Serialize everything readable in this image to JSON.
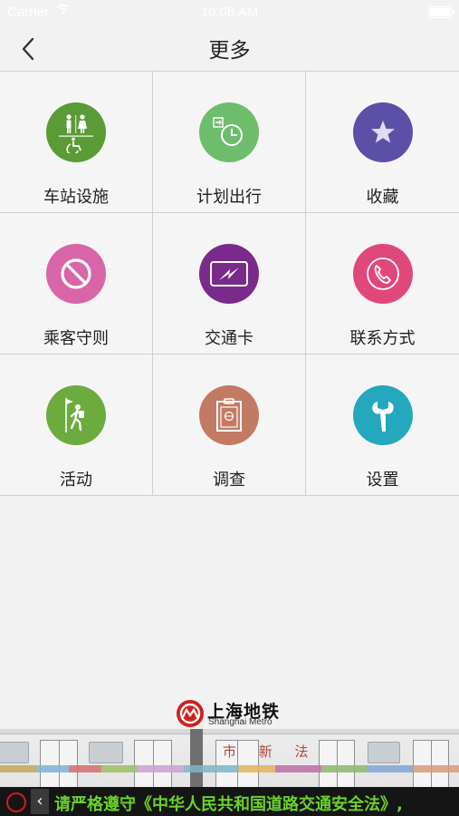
{
  "status_bar": {
    "carrier": "Carrier",
    "time": "10:08 AM"
  },
  "nav": {
    "title": "更多"
  },
  "items": [
    {
      "label": "车站设施",
      "icon": "restroom-accessibility-icon",
      "color": "#5a9b35"
    },
    {
      "label": "计划出行",
      "icon": "plan-clock-icon",
      "color": "#6dbd6d"
    },
    {
      "label": "收藏",
      "icon": "star-icon",
      "color": "#5c4fa8"
    },
    {
      "label": "乘客守则",
      "icon": "prohibited-icon",
      "color": "#d965a9"
    },
    {
      "label": "交通卡",
      "icon": "transit-card-icon",
      "color": "#7a2a8a"
    },
    {
      "label": "联系方式",
      "icon": "phone-icon",
      "color": "#e0487a"
    },
    {
      "label": "活动",
      "icon": "hiker-flag-icon",
      "color": "#6cab3e"
    },
    {
      "label": "调查",
      "icon": "clipboard-survey-icon",
      "color": "#c27a63"
    },
    {
      "label": "设置",
      "icon": "wrench-icon",
      "color": "#23a8bd"
    }
  ],
  "footer": {
    "logo_cn": "上海地铁",
    "logo_en": "Shanghai Metro",
    "train_text": "市 新 法",
    "ticker": "请严格遵守《中华人民共和国道路交通安全法》,"
  }
}
